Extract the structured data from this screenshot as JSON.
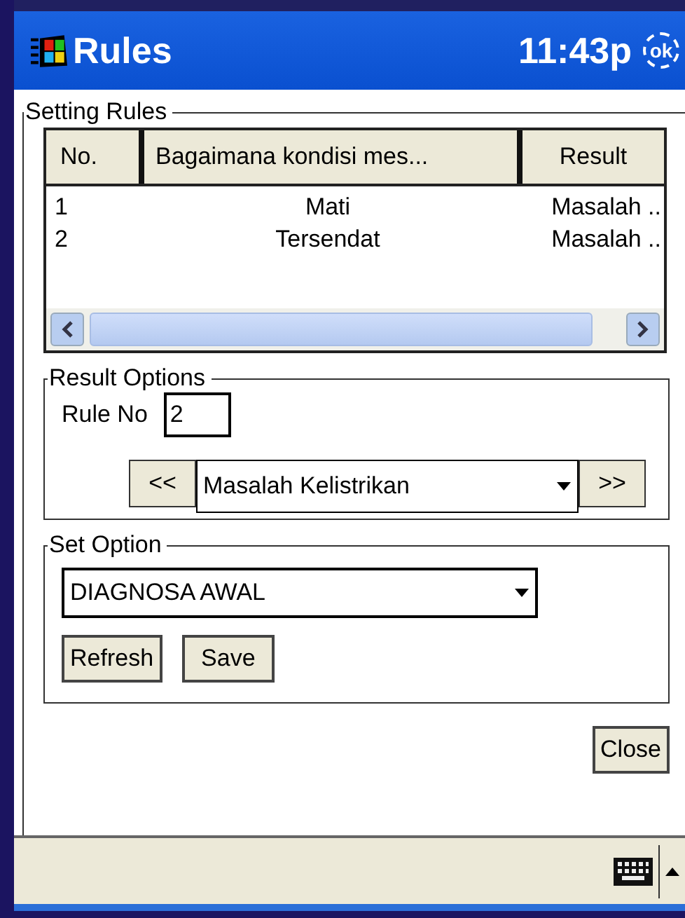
{
  "window": {
    "title": "Rules",
    "time": "11:43p",
    "ok_button": "ok"
  },
  "setting_rules": {
    "title": "Setting Rules",
    "table": {
      "columns": [
        "No.",
        "Bagaimana kondisi mes...",
        "Result"
      ],
      "rows": [
        [
          "1",
          "Mati",
          "Masalah .."
        ],
        [
          "2",
          "Tersendat",
          "Masalah .."
        ]
      ]
    }
  },
  "result_options": {
    "title": "Result Options",
    "rule_no_label": "Rule No",
    "rule_no_value": "2",
    "prev_button": "<<",
    "result_value": "Masalah Kelistrikan",
    "next_button": ">>"
  },
  "set_option": {
    "title": "Set Option",
    "value": "DIAGNOSA AWAL",
    "buttons": [
      "Refresh",
      "Save"
    ]
  },
  "close_button": "Close"
}
